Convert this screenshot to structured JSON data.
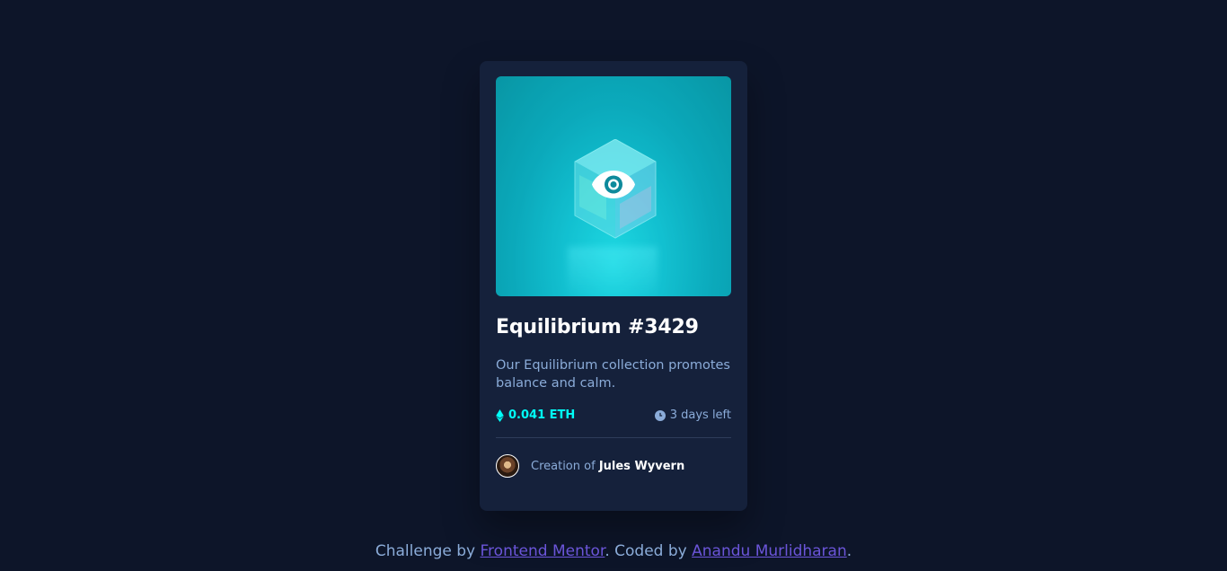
{
  "card": {
    "title": "Equilibrium #3429",
    "description": "Our Equilibrium collection promotes balance and calm.",
    "price": "0.041 ETH",
    "time_left": "3 days left",
    "creator_prefix": "Creation of",
    "creator_name": "Jules Wyvern",
    "price_icon": "ethereum-icon",
    "time_icon": "clock-icon",
    "overlay_icon": "eye-icon"
  },
  "footer": {
    "prefix": "Challenge by",
    "link1": "Frontend Mentor",
    "middle": ". Coded by",
    "link2": "Anandu Murlidharan",
    "suffix": "."
  },
  "colors": {
    "background": "#0d1529",
    "card": "#15213b",
    "accent_cyan": "#00fff8",
    "soft_blue": "#8bacd9",
    "link_purple": "#6b55d9"
  }
}
